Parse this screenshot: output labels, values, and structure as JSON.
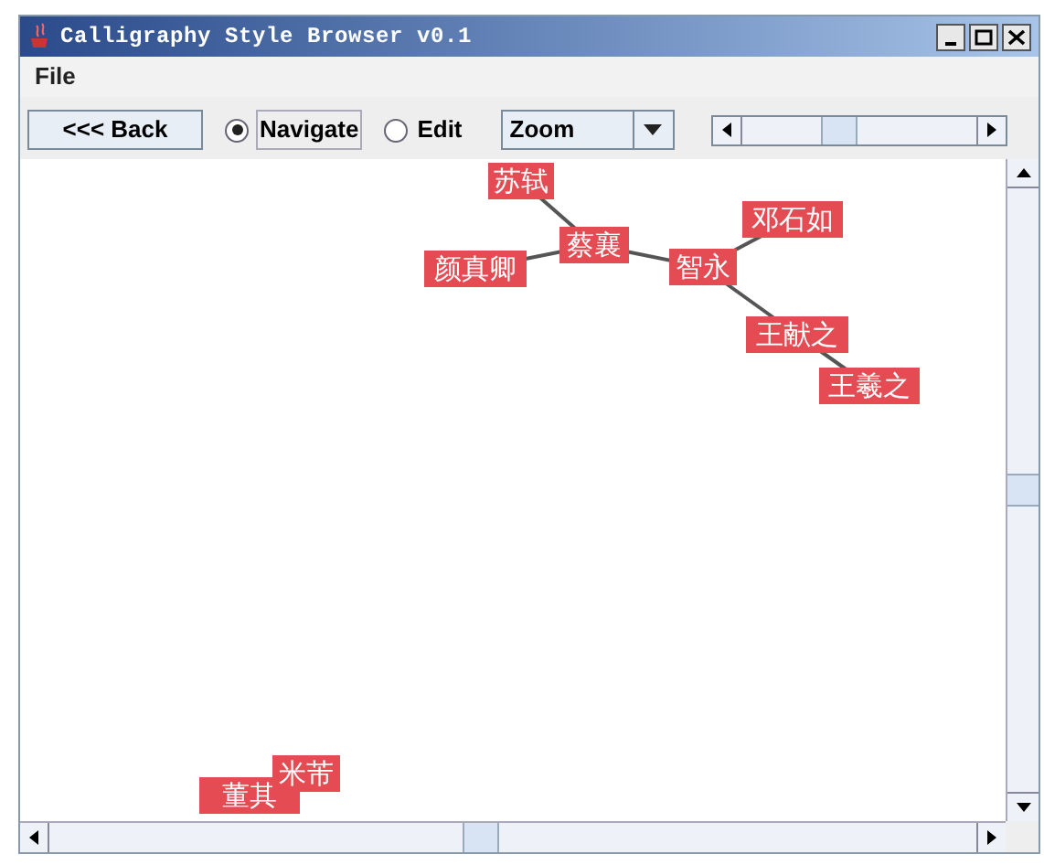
{
  "window": {
    "title": "Calligraphy Style Browser v0.1"
  },
  "menu": [
    "File"
  ],
  "toolbar": {
    "back": "<<< Back",
    "modes": [
      {
        "label": "Navigate",
        "selected": true
      },
      {
        "label": "Edit",
        "selected": false
      }
    ],
    "zoom_select": "Zoom",
    "zoom_level": {
      "level": 0.4
    }
  },
  "graph": {
    "nodes": [
      "苏轼",
      "蔡襄",
      "颜真卿",
      "智永",
      "邓石如",
      "王献之",
      "王羲之",
      "董其",
      "米芾"
    ]
  }
}
